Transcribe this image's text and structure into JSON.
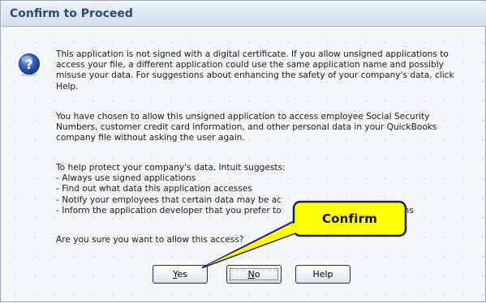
{
  "dialog": {
    "title": "Confirm to Proceed",
    "icon": "question-icon",
    "paragraph1": "This application is not signed with a digital certificate.  If you allow unsigned applications to access your file, a different application could use the same application name and possibly misuse your data.  For suggestions about enhancing the safety of your company's data, click Help.",
    "paragraph2": "You have chosen to allow this unsigned application to access employee Social Security Numbers, customer credit card information, and other personal data in your QuickBooks company file without asking the user again.",
    "suggest_lead": "To help protect your company's data, Intuit suggests:",
    "suggestions": [
      "Always use signed applications",
      "Find out what data this application accesses",
      "Notify your employees that certain data may be ac",
      "Inform the application developer that you prefer to"
    ],
    "suggestion_tail": "ons",
    "question": "Are you sure you want to allow this access?"
  },
  "buttons": {
    "yes_mnemonic": "Y",
    "yes_rest": "es",
    "no_mnemonic": "N",
    "no_rest": "o",
    "help": "Help"
  },
  "callout": {
    "label": "Confirm",
    "fill": "#ffff00",
    "stroke": "#1a1a80"
  },
  "colors": {
    "title_text": "#274b7a",
    "button_border": "#1c2f63"
  }
}
